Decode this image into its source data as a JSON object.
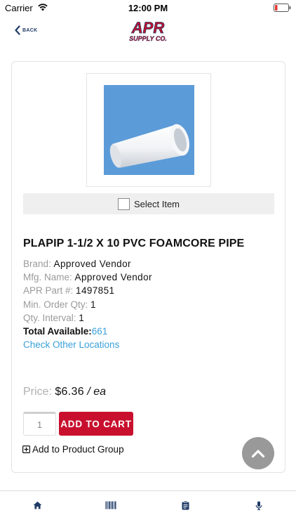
{
  "status_bar": {
    "carrier": "Carrier",
    "time": "12:00 PM",
    "wifi_icon": "wifi-icon",
    "battery_icon": "battery-low-icon",
    "battery_color": "#e53935"
  },
  "header": {
    "back_label": "BACK",
    "back_icon": "chevron-left-icon",
    "logo_line1": "APR",
    "logo_line2": "SUPPLY CO."
  },
  "product": {
    "select_label": "Select Item",
    "title": "PLAPIP 1-1/2 X 10 PVC FOAMCORE PIPE",
    "brand_label": "Brand:",
    "brand_value": "Approved Vendor",
    "mfg_label": "Mfg. Name:",
    "mfg_value": "Approved Vendor",
    "part_label": "APR Part #:",
    "part_value": "1497851",
    "min_qty_label": "Min. Order Qty:",
    "min_qty_value": "1",
    "interval_label": "Qty. Interval:",
    "interval_value": "1",
    "total_label": "Total Available:",
    "total_value": "661",
    "check_locations": "Check Other Locations",
    "price_label": "Price:",
    "price_value": "$6.36",
    "price_sep": "/",
    "price_unit": "ea",
    "qty_value": "1",
    "add_to_cart": "ADD TO CART",
    "add_group": "Add to Product Group"
  },
  "tab_bar": {
    "items": [
      {
        "icon": "home-icon"
      },
      {
        "icon": "barcode-icon"
      },
      {
        "icon": "clipboard-icon"
      },
      {
        "icon": "microphone-icon"
      }
    ]
  },
  "colors": {
    "brand_red": "#c8102e",
    "brand_navy": "#1f3b66",
    "link_blue": "#3aa0d9"
  }
}
